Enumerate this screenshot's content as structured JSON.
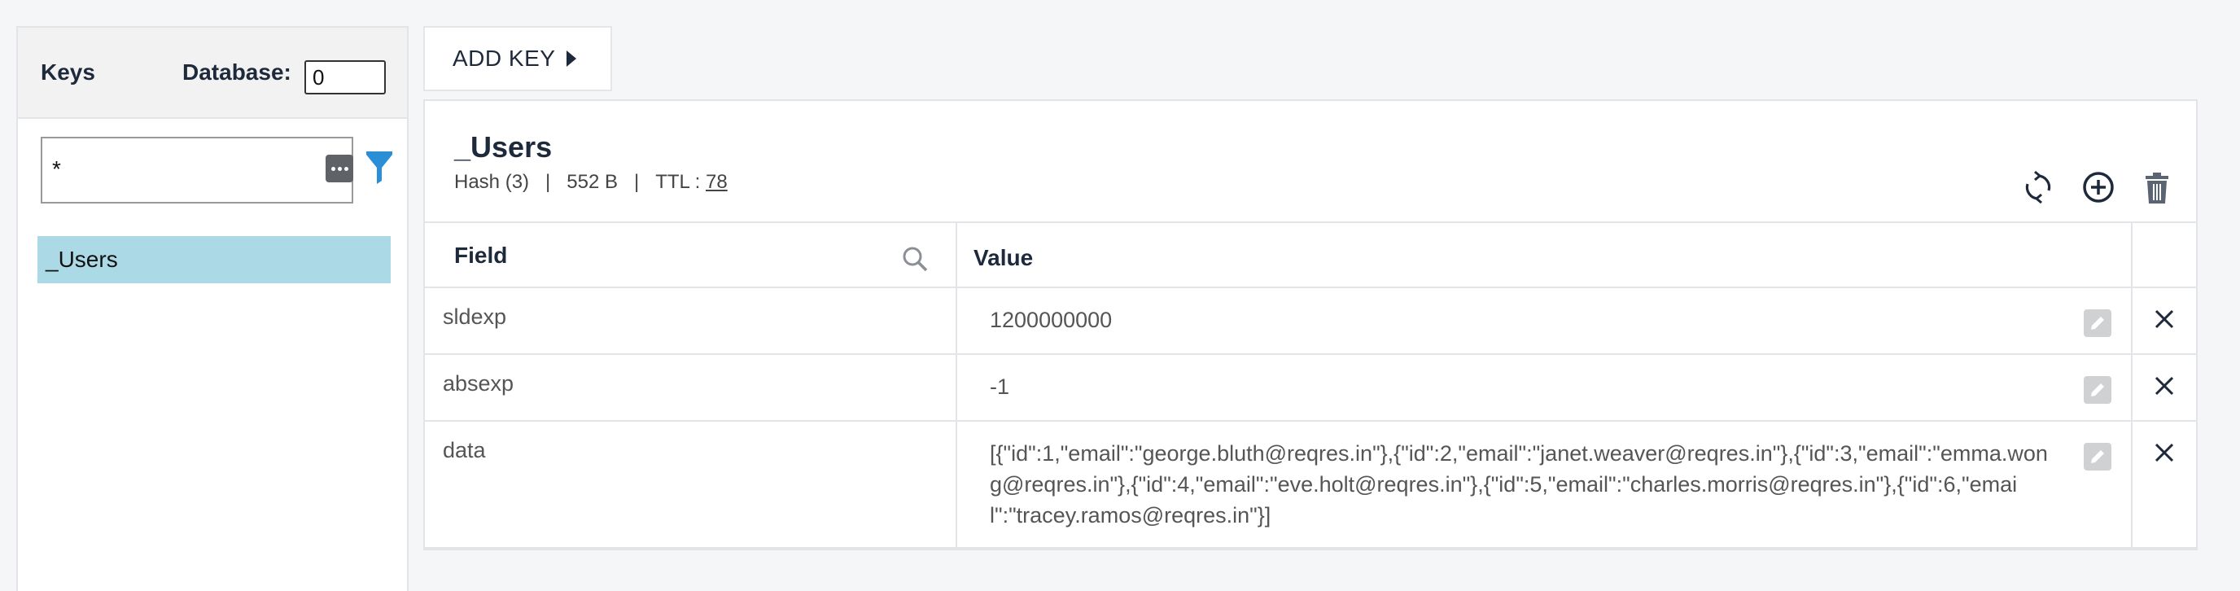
{
  "sidebar": {
    "title": "Keys",
    "database_label": "Database:",
    "database_value": "0",
    "filter_value": "*",
    "keys": [
      "_Users"
    ]
  },
  "toolbar": {
    "add_key_label": "ADD KEY"
  },
  "key_detail": {
    "name": "_Users",
    "type": "Hash (3)",
    "size": "552 B",
    "ttl_label": "TTL :",
    "ttl_value": "78",
    "separator": "|"
  },
  "table": {
    "headers": {
      "field": "Field",
      "value": "Value"
    },
    "rows": [
      {
        "field": "sldexp",
        "value": "1200000000"
      },
      {
        "field": "absexp",
        "value": "-1"
      },
      {
        "field": "data",
        "value": "[{\"id\":1,\"email\":\"george.bluth@reqres.in\"},{\"id\":2,\"email\":\"janet.weaver@reqres.in\"},{\"id\":3,\"email\":\"emma.wong@reqres.in\"},{\"id\":4,\"email\":\"eve.holt@reqres.in\"},{\"id\":5,\"email\":\"charles.morris@reqres.in\"},{\"id\":6,\"email\":\"tracey.ramos@reqres.in\"}]"
      }
    ]
  },
  "icons": {
    "refresh": "refresh-icon",
    "add": "add-circle-icon",
    "delete": "trash-icon",
    "filter": "funnel-icon",
    "more": "more-icon",
    "search": "search-icon",
    "edit": "pencil-icon",
    "remove": "close-icon"
  },
  "colors": {
    "selected_key_bg": "#acd9e6",
    "filter_accent": "#2a8fd6",
    "heading": "#1e2a3b"
  }
}
